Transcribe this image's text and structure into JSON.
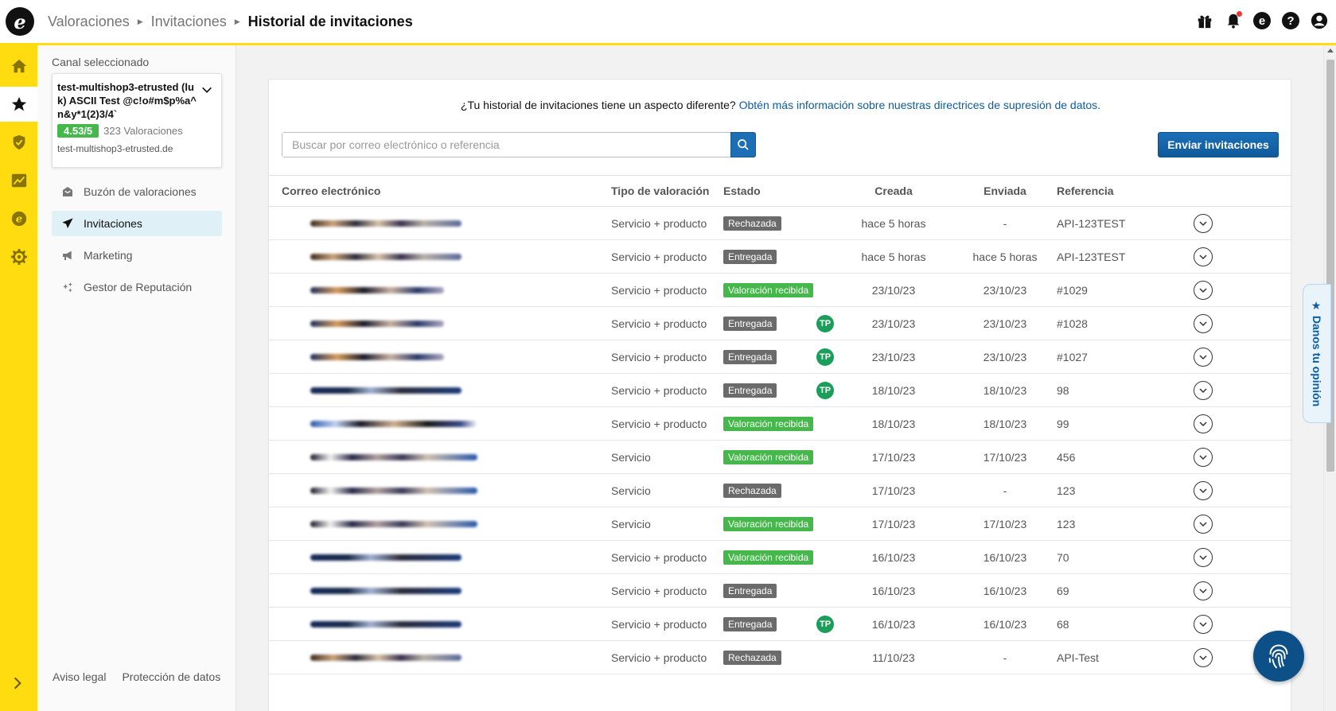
{
  "header": {
    "logo_letter": "e",
    "breadcrumb": [
      "Valoraciones",
      "Invitaciones",
      "Historial de invitaciones"
    ]
  },
  "rail": {
    "items": [
      "home-icon",
      "star-icon",
      "shield-check-icon",
      "chart-icon",
      "etrusted-icon",
      "gear-icon"
    ],
    "expand": "chevron-right-icon"
  },
  "sidepanel": {
    "channel_label": "Canal seleccionado",
    "channel_name": "test-multishop3-etrusted (luk) ASCII Test @c!o#m$p%a^n&y*1(2)3/4`",
    "rating": "4.53/5",
    "reviews": "323 Valoraciones",
    "url": "test-multishop3-etrusted.de",
    "nav": [
      {
        "label": "Buzón de valoraciones",
        "icon": "inbox-icon"
      },
      {
        "label": "Invitaciones",
        "icon": "paper-plane-icon"
      },
      {
        "label": "Marketing",
        "icon": "megaphone-icon"
      },
      {
        "label": "Gestor de Reputación",
        "icon": "sparkles-icon"
      }
    ],
    "legal": {
      "aviso": "Aviso legal",
      "proteccion": "Protección de datos"
    }
  },
  "main": {
    "notice_text": "¿Tu historial de invitaciones tiene un aspecto diferente?",
    "notice_link": "Obtén más información sobre nuestras directrices de supresión de datos.",
    "search_placeholder": "Buscar por correo electrónico o referencia",
    "send_button": "Enviar invitaciones",
    "columns": {
      "email": "Correo electrónico",
      "type": "Tipo de valoración",
      "status": "Estado",
      "created": "Creada",
      "sent": "Enviada",
      "reference": "Referencia"
    },
    "rows": [
      {
        "type": "Servicio + producto",
        "status": "Rechazada",
        "tp": "",
        "created": "hace 5 horas",
        "sent": "-",
        "ref": "API-123TEST"
      },
      {
        "type": "Servicio + producto",
        "status": "Entregada",
        "tp": "",
        "created": "hace 5 horas",
        "sent": "hace 5 horas",
        "ref": "API-123TEST"
      },
      {
        "type": "Servicio + producto",
        "status": "Valoración recibida",
        "tp": "",
        "created": "23/10/23",
        "sent": "23/10/23",
        "ref": "#1029"
      },
      {
        "type": "Servicio + producto",
        "status": "Entregada",
        "tp": "TP",
        "created": "23/10/23",
        "sent": "23/10/23",
        "ref": "#1028"
      },
      {
        "type": "Servicio + producto",
        "status": "Entregada",
        "tp": "TP",
        "created": "23/10/23",
        "sent": "23/10/23",
        "ref": "#1027"
      },
      {
        "type": "Servicio + producto",
        "status": "Entregada",
        "tp": "TP",
        "created": "18/10/23",
        "sent": "18/10/23",
        "ref": "98"
      },
      {
        "type": "Servicio + producto",
        "status": "Valoración recibida",
        "tp": "",
        "created": "18/10/23",
        "sent": "18/10/23",
        "ref": "99"
      },
      {
        "type": "Servicio",
        "status": "Valoración recibida",
        "tp": "",
        "created": "17/10/23",
        "sent": "17/10/23",
        "ref": "456"
      },
      {
        "type": "Servicio",
        "status": "Rechazada",
        "tp": "",
        "created": "17/10/23",
        "sent": "-",
        "ref": "123"
      },
      {
        "type": "Servicio",
        "status": "Valoración recibida",
        "tp": "",
        "created": "17/10/23",
        "sent": "17/10/23",
        "ref": "123"
      },
      {
        "type": "Servicio + producto",
        "status": "Valoración recibida",
        "tp": "",
        "created": "16/10/23",
        "sent": "16/10/23",
        "ref": "70"
      },
      {
        "type": "Servicio + producto",
        "status": "Entregada",
        "tp": "",
        "created": "16/10/23",
        "sent": "16/10/23",
        "ref": "69"
      },
      {
        "type": "Servicio + producto",
        "status": "Entregada",
        "tp": "TP",
        "created": "16/10/23",
        "sent": "16/10/23",
        "ref": "68"
      },
      {
        "type": "Servicio + producto",
        "status": "Rechazada",
        "tp": "",
        "created": "11/10/23",
        "sent": "-",
        "ref": "API-Test"
      }
    ]
  },
  "feedback_tab": "★ Danos tu opinión",
  "colors": {
    "brand_yellow": "#ffdc0f",
    "accent_blue": "#1565c0",
    "status_green": "#46b74b",
    "status_gray": "#6b6b6b"
  }
}
